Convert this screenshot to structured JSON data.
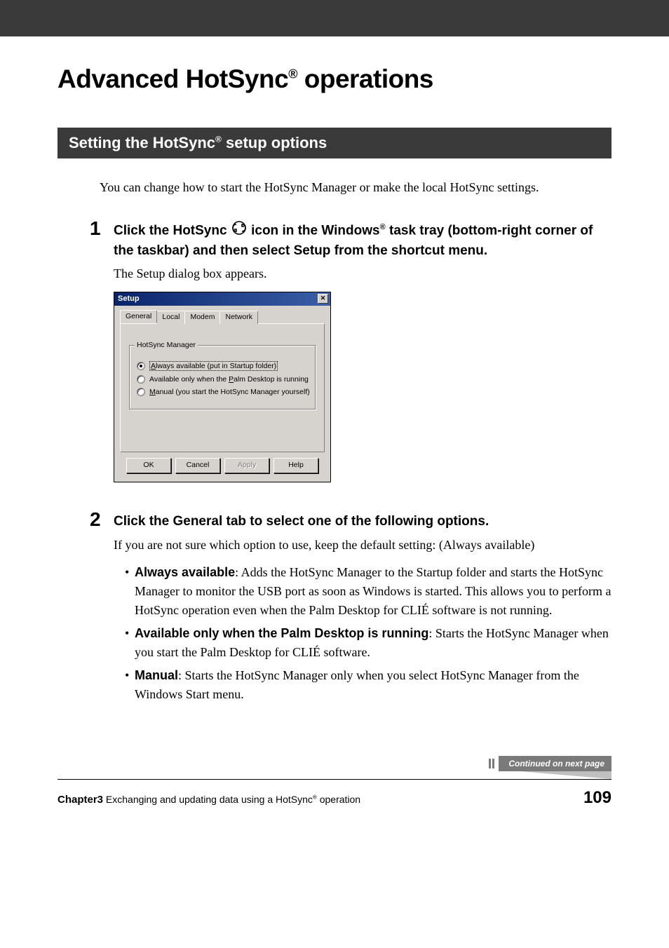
{
  "heading": {
    "prefix": "Advanced HotSync",
    "reg": "®",
    "suffix": " operations"
  },
  "section": {
    "prefix": "Setting the HotSync",
    "reg": "®",
    "suffix": " setup options"
  },
  "intro": "You can change how to start the HotSync Manager or make the local HotSync settings.",
  "step1": {
    "num": "1",
    "inst_a": "Click the HotSync ",
    "inst_b": " icon in the Windows",
    "reg": "®",
    "inst_c": " task tray (bottom-right corner of the taskbar) and then select Setup from the shortcut menu.",
    "result": "The Setup dialog box appears."
  },
  "dialog": {
    "title": "Setup",
    "tabs": [
      "General",
      "Local",
      "Modem",
      "Network"
    ],
    "group_title": "HotSync Manager",
    "radios": [
      {
        "u": "A",
        "rest": "lways available (put in Startup folder)",
        "selected": true
      },
      {
        "u": "P",
        "pre": "Available only when the ",
        "rest": "alm Desktop is running",
        "selected": false
      },
      {
        "u": "M",
        "rest": "anual (you start the HotSync Manager yourself)",
        "selected": false
      }
    ],
    "buttons": {
      "ok": "OK",
      "cancel": "Cancel",
      "apply": "Apply",
      "help": "Help"
    }
  },
  "step2": {
    "num": "2",
    "inst": "Click the General tab to select one of the following options.",
    "result": "If you are not sure which option to use, keep the default setting: (Always available)",
    "bullets": [
      {
        "bold": "Always available",
        "text": ": Adds the HotSync Manager to the Startup folder and starts the HotSync Manager to monitor the USB port as soon as Windows is started. This allows you to perform a HotSync operation even when the Palm Desktop for CLIÉ software is not running."
      },
      {
        "bold": "Available only when the Palm Desktop is running",
        "text": ": Starts the HotSync Manager when you start the Palm Desktop for CLIÉ software."
      },
      {
        "bold": "Manual",
        "text": ": Starts the HotSync Manager only when you select HotSync Manager from the Windows Start menu."
      }
    ]
  },
  "continued": "Continued on next page",
  "footer": {
    "chapter_label": "Chapter3",
    "chapter_text_a": "  Exchanging and updating data using a HotSync",
    "reg": "®",
    "chapter_text_b": "  operation",
    "page": "109"
  }
}
